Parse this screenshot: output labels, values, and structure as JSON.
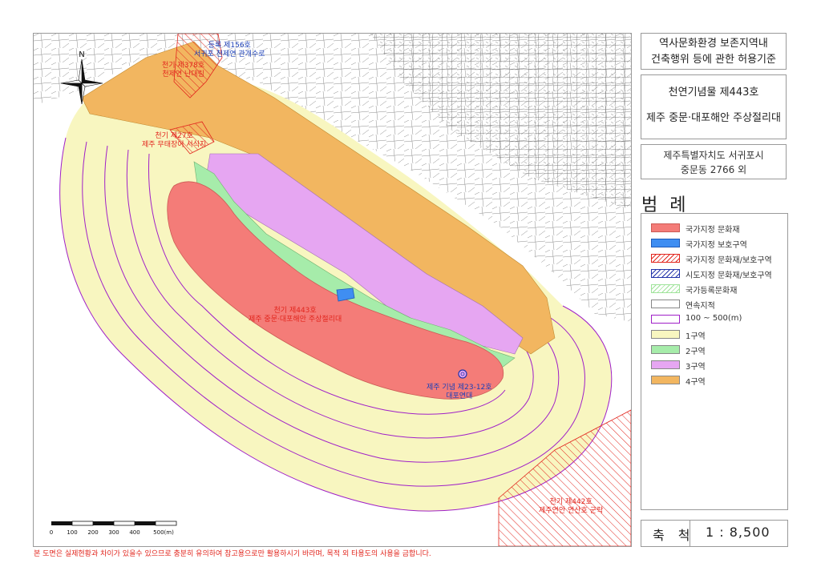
{
  "title_box": {
    "line1": "역사문화환경 보존지역내",
    "line2": "건축행위 등에 관한 허용기준"
  },
  "monument": {
    "line1": "천연기념물 제443호",
    "line2": "제주 중문·대포해안 주상절리대"
  },
  "address": {
    "line1": "제주특별자치도 서귀포시",
    "line2": "중문동 2766 외"
  },
  "legend": {
    "title": "범 례",
    "items": [
      {
        "label": "국가지정 문화재",
        "color": "#f47c78",
        "pattern": "solid"
      },
      {
        "label": "국가지정 보호구역",
        "color": "#3f8ef2",
        "pattern": "solid"
      },
      {
        "label": "국가지정 문화재/보호구역",
        "color": "#e2261e",
        "pattern": "hatch"
      },
      {
        "label": "시도지정 문화재/보호구역",
        "color": "#2233aa",
        "pattern": "hatch"
      },
      {
        "label": "국가등록문화재",
        "color": "#9fe39a",
        "pattern": "hatch"
      },
      {
        "label": "연속지적",
        "color": "#ffffff",
        "pattern": "solid"
      },
      {
        "label": "100 ~ 500(m)",
        "color": "#a020c8",
        "pattern": "line"
      },
      {
        "label": "1구역",
        "color": "#f8f6c0",
        "pattern": "solid"
      },
      {
        "label": "2구역",
        "color": "#a6ecaa",
        "pattern": "solid"
      },
      {
        "label": "3구역",
        "color": "#e6a6f2",
        "pattern": "solid"
      },
      {
        "label": "4구역",
        "color": "#f2b660",
        "pattern": "solid"
      }
    ]
  },
  "scale": {
    "label": "축 척",
    "value": "1 : 8,500"
  },
  "scalebar": {
    "ticks": [
      "0",
      "100",
      "200",
      "300",
      "400",
      "500(m)"
    ]
  },
  "north_label": "N",
  "map_labels": {
    "jeju_443": {
      "line1": "천기 제443호",
      "line2": "제주 중문·대포해안 주상절리대"
    },
    "jeju_442": {
      "line1": "천기 제442호",
      "line2": "제주연안 연산호 군락"
    },
    "daepo": {
      "line1": "제주 기념 제23-12호",
      "line2": "대포연대"
    },
    "north_blue": {
      "line1": "등록 제156호",
      "line2": "서귀포 천제연 관개수로"
    },
    "north_red": {
      "line1": "천기 제378호",
      "line2": "천제연 난대림"
    },
    "west_red": {
      "line1": "천기 제27호",
      "line2": "제주 무태장어 서식지"
    }
  },
  "disclaimer": "본 도면은 실제현황과 차이가 있을수 있으므로 충분히 유의하여 참고용으로만 활용하시기 바라며, 목적 외 타용도의 사용을 금합니다.",
  "colors": {
    "zone1": "#f8f6c0",
    "zone2": "#a6ecaa",
    "zone3": "#e6a6f2",
    "zone4": "#f2b660",
    "heritage": "#f47c78",
    "protect": "#3f8ef2",
    "ring": "#a020c8",
    "red_hatch": "#e2261e"
  }
}
